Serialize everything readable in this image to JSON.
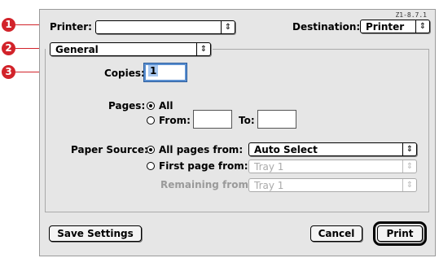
{
  "dialog": {
    "ref": "Z1-8.7.1",
    "printer_label": "Printer:",
    "destination_label": "Destination:",
    "destination_value": "Printer",
    "panel_value": "General",
    "copies_label": "Copies:",
    "copies_value": "1",
    "pages_label": "Pages:",
    "pages_all": "All",
    "pages_from": "From:",
    "pages_to": "To:",
    "paper_source_label": "Paper Source:",
    "all_pages_from": "All pages from:",
    "all_pages_value": "Auto Select",
    "first_page_from": "First page from:",
    "first_page_value": "Tray 1",
    "remaining_from": "Remaining from:",
    "remaining_value": "Tray 1",
    "save_settings": "Save Settings",
    "cancel": "Cancel",
    "print": "Print"
  },
  "callouts": [
    "1",
    "2",
    "3"
  ],
  "colors": {
    "callout": "#d2232a",
    "focus": "#5a8fd0"
  }
}
